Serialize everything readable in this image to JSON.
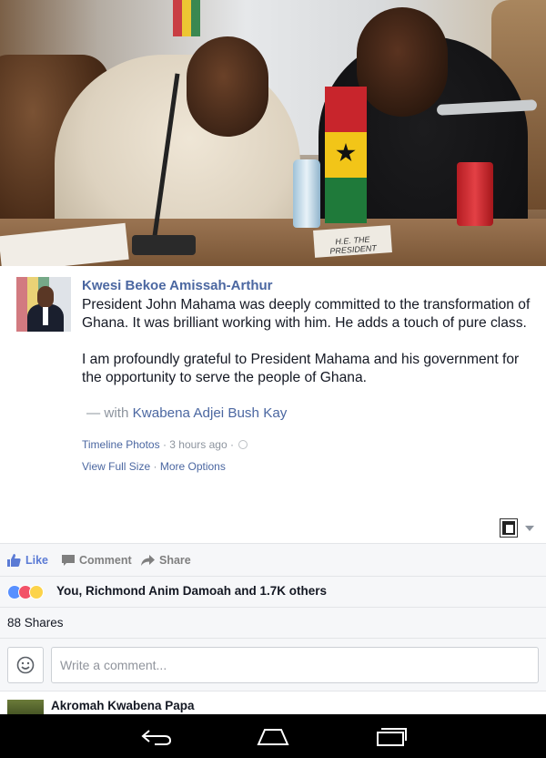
{
  "photo": {
    "placard_text": "H.E. THE PRESIDENT"
  },
  "post": {
    "author": "Kwesi Bekoe Amissah-Arthur",
    "paragraph1": "President John Mahama was deeply committed to the transformation of Ghana. It was brilliant working with him. He adds a touch of pure class.",
    "paragraph2": "I am profoundly grateful to President Mahama and his government for the opportunity to serve the people of Ghana.",
    "with_prefix": "— with",
    "tagged": "Kwabena Adjei Bush Kay",
    "album": "Timeline Photos",
    "time": "· 3 hours ago ·",
    "view_full_size": "View Full Size",
    "separator": "·",
    "more_options": "More Options"
  },
  "actions": {
    "like": "Like",
    "comment": "Comment",
    "share": "Share"
  },
  "reactions": {
    "text": "You, Richmond Anim Damoah and 1.7K others"
  },
  "shares": {
    "text": "88 Shares"
  },
  "comment_box": {
    "placeholder": "Write a comment..."
  },
  "comments": [
    {
      "name": "Akromah Kwabena Papa"
    }
  ],
  "colors": {
    "link": "#4b67a1",
    "like_blue": "#5b7bd5",
    "meta_grey": "#8d949e",
    "panel_bg": "#f6f7f9"
  }
}
